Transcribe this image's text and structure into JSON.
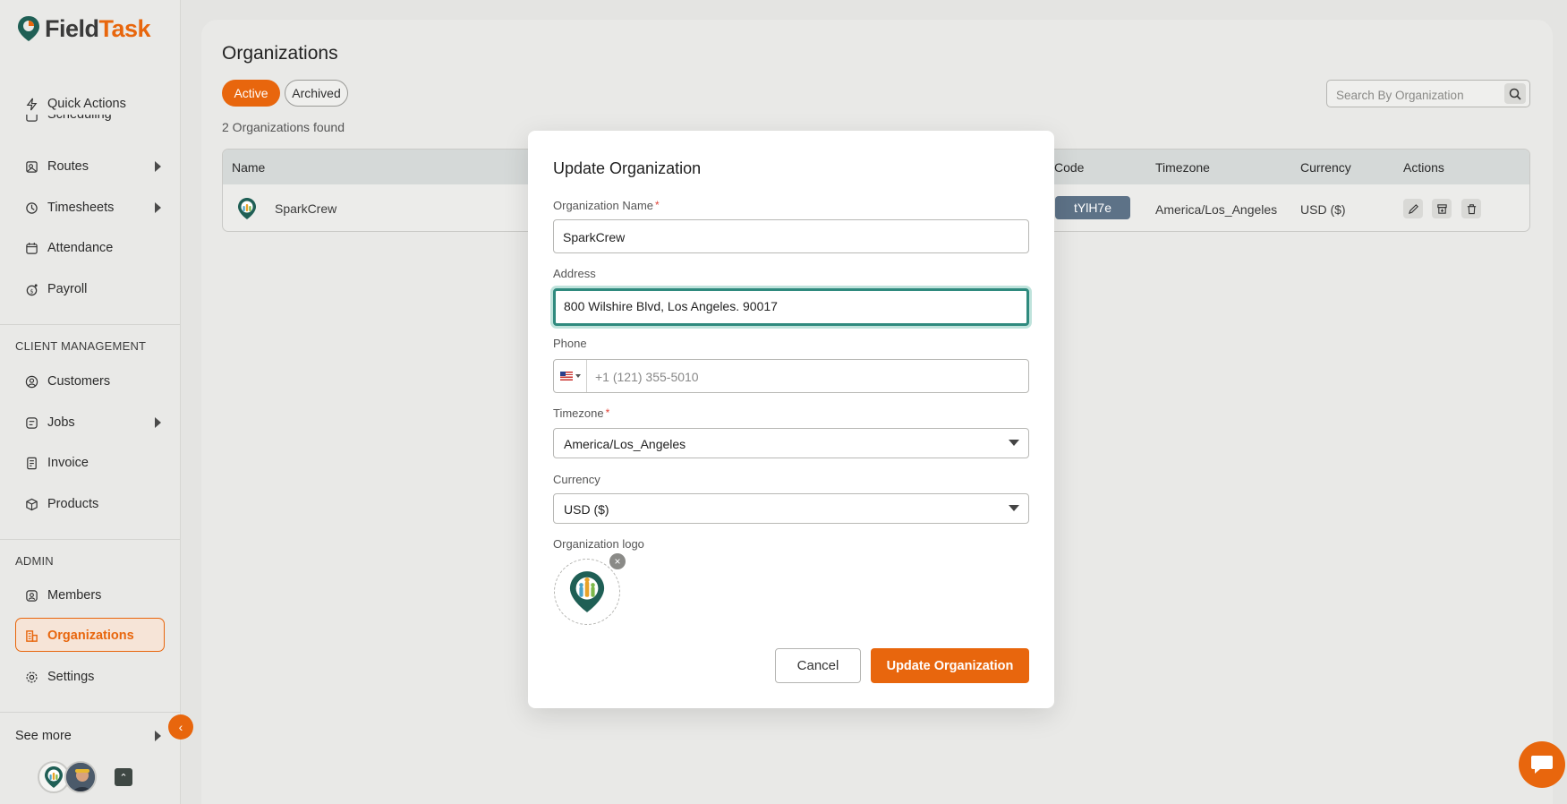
{
  "app": {
    "name_part1": "Field",
    "name_part2": "Task",
    "brand_color": "#e8660d"
  },
  "sidebar": {
    "items_top": [
      {
        "label": "Quick Actions",
        "icon": "lightning-icon"
      },
      {
        "label": "Scheduling",
        "icon": "calendar-icon"
      },
      {
        "label": "Routes",
        "icon": "map-icon",
        "has_submenu": true
      },
      {
        "label": "Timesheets",
        "icon": "clock-icon",
        "has_submenu": true
      },
      {
        "label": "Attendance",
        "icon": "calendar-check-icon"
      },
      {
        "label": "Payroll",
        "icon": "payroll-icon"
      }
    ],
    "client_section": "CLIENT MANAGEMENT",
    "client_items": [
      {
        "label": "Customers",
        "icon": "user-circle-icon"
      },
      {
        "label": "Jobs",
        "icon": "jobs-icon",
        "has_submenu": true
      },
      {
        "label": "Invoice",
        "icon": "invoice-icon"
      },
      {
        "label": "Products",
        "icon": "box-icon"
      }
    ],
    "admin_section": "ADMIN",
    "admin_items": [
      {
        "label": "Members",
        "icon": "user-square-icon"
      },
      {
        "label": "Organizations",
        "icon": "organization-icon",
        "active": true
      },
      {
        "label": "Settings",
        "icon": "gear-icon"
      }
    ],
    "see_more": "See more"
  },
  "page": {
    "title": "Organizations",
    "filters": {
      "active": "Active",
      "archived": "Archived"
    },
    "found_text": "2 Organizations found",
    "search_placeholder": "Search By Organization"
  },
  "table": {
    "columns": {
      "name": "Name",
      "code": "Code",
      "timezone": "Timezone",
      "currency": "Currency",
      "actions": "Actions"
    },
    "rows": [
      {
        "name": "SparkCrew",
        "code": "tYlH7e",
        "timezone": "America/Los_Angeles",
        "currency": "USD ($)"
      }
    ]
  },
  "modal": {
    "title": "Update Organization",
    "org_name_label": "Organization Name",
    "org_name_value": "SparkCrew",
    "address_label": "Address",
    "address_value": "800 Wilshire Blvd, Los Angeles. 90017",
    "phone_label": "Phone",
    "phone_placeholder": "+1 (121) 355-5010",
    "timezone_label": "Timezone",
    "timezone_value": "America/Los_Angeles",
    "currency_label": "Currency",
    "currency_value": "USD ($)",
    "logo_label": "Organization logo",
    "cancel_label": "Cancel",
    "submit_label": "Update Organization"
  }
}
